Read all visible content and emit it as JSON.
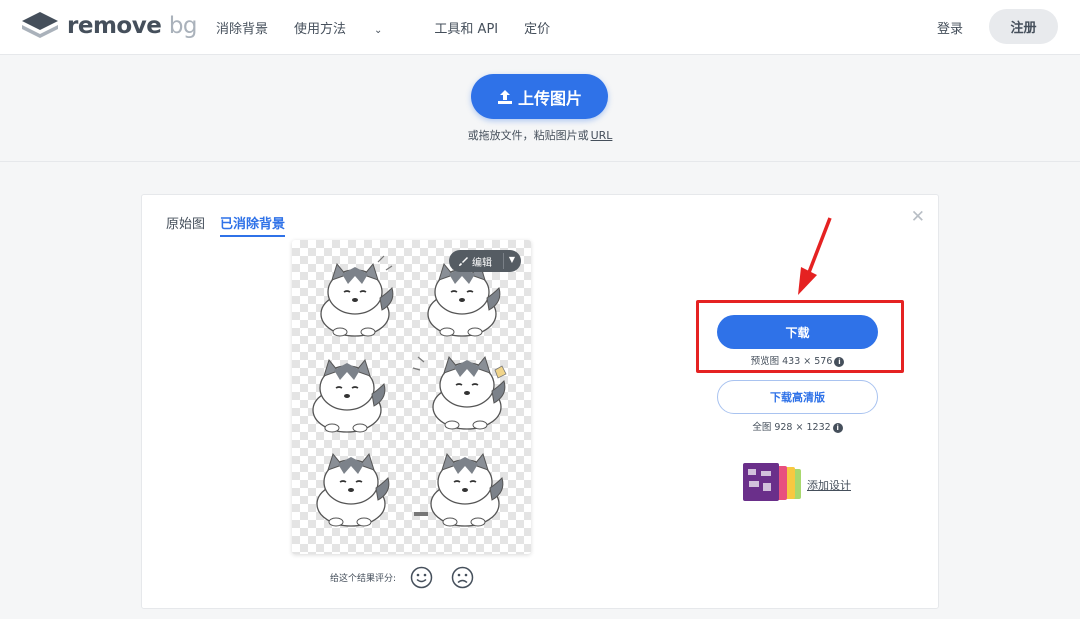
{
  "header": {
    "logo_main": "remove",
    "logo_suffix": "bg",
    "nav": [
      "消除背景",
      "使用方法",
      "工具和 API",
      "定价"
    ],
    "login": "登录",
    "signup": "注册"
  },
  "upload": {
    "button_label": "上传图片",
    "hint": "或拖放文件，粘贴图片或",
    "hint_link": "URL"
  },
  "result": {
    "tabs": [
      "原始图",
      "已消除背景"
    ],
    "active_tab": 1,
    "edit_label": "编辑",
    "rating_label": "给这个结果评分:",
    "download_label": "下载",
    "download_info": "预览图 433 × 576",
    "download_hd_label": "下载高清版",
    "download_hd_info": "全图 928 × 1232",
    "add_design_label": "添加设计"
  },
  "colors": {
    "accent": "#2f72e8",
    "highlight": "#e52222"
  }
}
